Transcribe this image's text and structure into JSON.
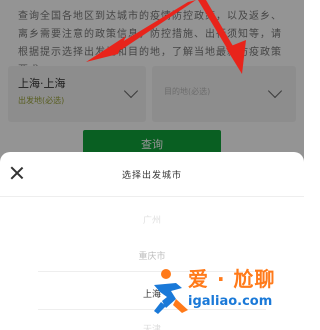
{
  "background": {
    "intro_text": "查询全国各地区到达城市的疫情防控政策，以及返乡、离乡需要注意的政策信息，防控措施、出行须知等，请根据提示选择出发地和目的地，了解当地最新防疫政策要求。",
    "from_select": {
      "value": "上海·上海",
      "sub": "出发地(必选)"
    },
    "to_select": {
      "value": "目的地(必选)"
    },
    "query_button": "查询"
  },
  "sheet": {
    "title": "选择出发城市",
    "options": [
      "广州",
      "重庆市",
      "上海",
      "天津"
    ],
    "selected_index": 2
  },
  "watermark": {
    "line1": "爱 · 尬聊",
    "line2": "igaliao.com"
  },
  "colors": {
    "accent_green": "#11a43c",
    "arrow_red": "#e8241b",
    "watermark_orange": "#ff7a1a",
    "watermark_blue": "#1a79d8"
  }
}
